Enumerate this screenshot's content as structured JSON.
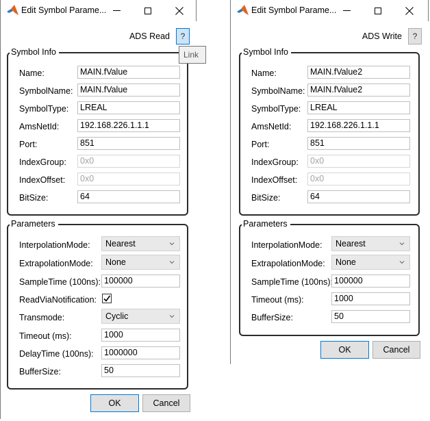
{
  "windows": [
    {
      "title": "Edit Symbol Parame...",
      "block_label": "ADS Read",
      "help_label": "?",
      "tooltip": "Link",
      "symbol_info": {
        "legend": "Symbol Info",
        "fields": [
          {
            "label": "Name:",
            "value": "MAIN.fValue",
            "disabled": false
          },
          {
            "label": "SymbolName:",
            "value": "MAIN.fValue",
            "disabled": false
          },
          {
            "label": "SymbolType:",
            "value": "LREAL",
            "disabled": false
          },
          {
            "label": "AmsNetId:",
            "value": "192.168.226.1.1.1",
            "disabled": false
          },
          {
            "label": "Port:",
            "value": "851",
            "disabled": false
          },
          {
            "label": "IndexGroup:",
            "value": "0x0",
            "disabled": true
          },
          {
            "label": "IndexOffset:",
            "value": "0x0",
            "disabled": true
          },
          {
            "label": "BitSize:",
            "value": "64",
            "disabled": false
          }
        ]
      },
      "parameters": {
        "legend": "Parameters",
        "interpolation": {
          "label": "InterpolationMode:",
          "value": "Nearest"
        },
        "extrapolation": {
          "label": "ExtrapolationMode:",
          "value": "None"
        },
        "sample_time": {
          "label": "SampleTime (100ns):",
          "value": "100000"
        },
        "read_via_notification": {
          "label": "ReadViaNotification:",
          "checked": true
        },
        "transmode": {
          "label": "Transmode:",
          "value": "Cyclic"
        },
        "timeout": {
          "label": "Timeout (ms):",
          "value": "1000"
        },
        "delay_time": {
          "label": "DelayTime (100ns):",
          "value": "1000000"
        },
        "buffer_size": {
          "label": "BufferSize:",
          "value": "50"
        }
      },
      "ok_label": "OK",
      "cancel_label": "Cancel"
    },
    {
      "title": "Edit Symbol Parame...",
      "block_label": "ADS Write",
      "help_label": "?",
      "symbol_info": {
        "legend": "Symbol Info",
        "fields": [
          {
            "label": "Name:",
            "value": "MAIN.fValue2",
            "disabled": false
          },
          {
            "label": "SymbolName:",
            "value": "MAIN.fValue2",
            "disabled": false
          },
          {
            "label": "SymbolType:",
            "value": "LREAL",
            "disabled": false
          },
          {
            "label": "AmsNetId:",
            "value": "192.168.226.1.1.1",
            "disabled": false
          },
          {
            "label": "Port:",
            "value": "851",
            "disabled": false
          },
          {
            "label": "IndexGroup:",
            "value": "0x0",
            "disabled": true
          },
          {
            "label": "IndexOffset:",
            "value": "0x0",
            "disabled": true
          },
          {
            "label": "BitSize:",
            "value": "64",
            "disabled": false
          }
        ]
      },
      "parameters": {
        "legend": "Parameters",
        "interpolation": {
          "label": "InterpolationMode:",
          "value": "Nearest"
        },
        "extrapolation": {
          "label": "ExtrapolationMode:",
          "value": "None"
        },
        "sample_time": {
          "label": "SampleTime (100ns):",
          "value": "100000"
        },
        "timeout": {
          "label": "Timeout (ms):",
          "value": "1000"
        },
        "buffer_size": {
          "label": "BufferSize:",
          "value": "50"
        }
      },
      "ok_label": "OK",
      "cancel_label": "Cancel"
    }
  ]
}
